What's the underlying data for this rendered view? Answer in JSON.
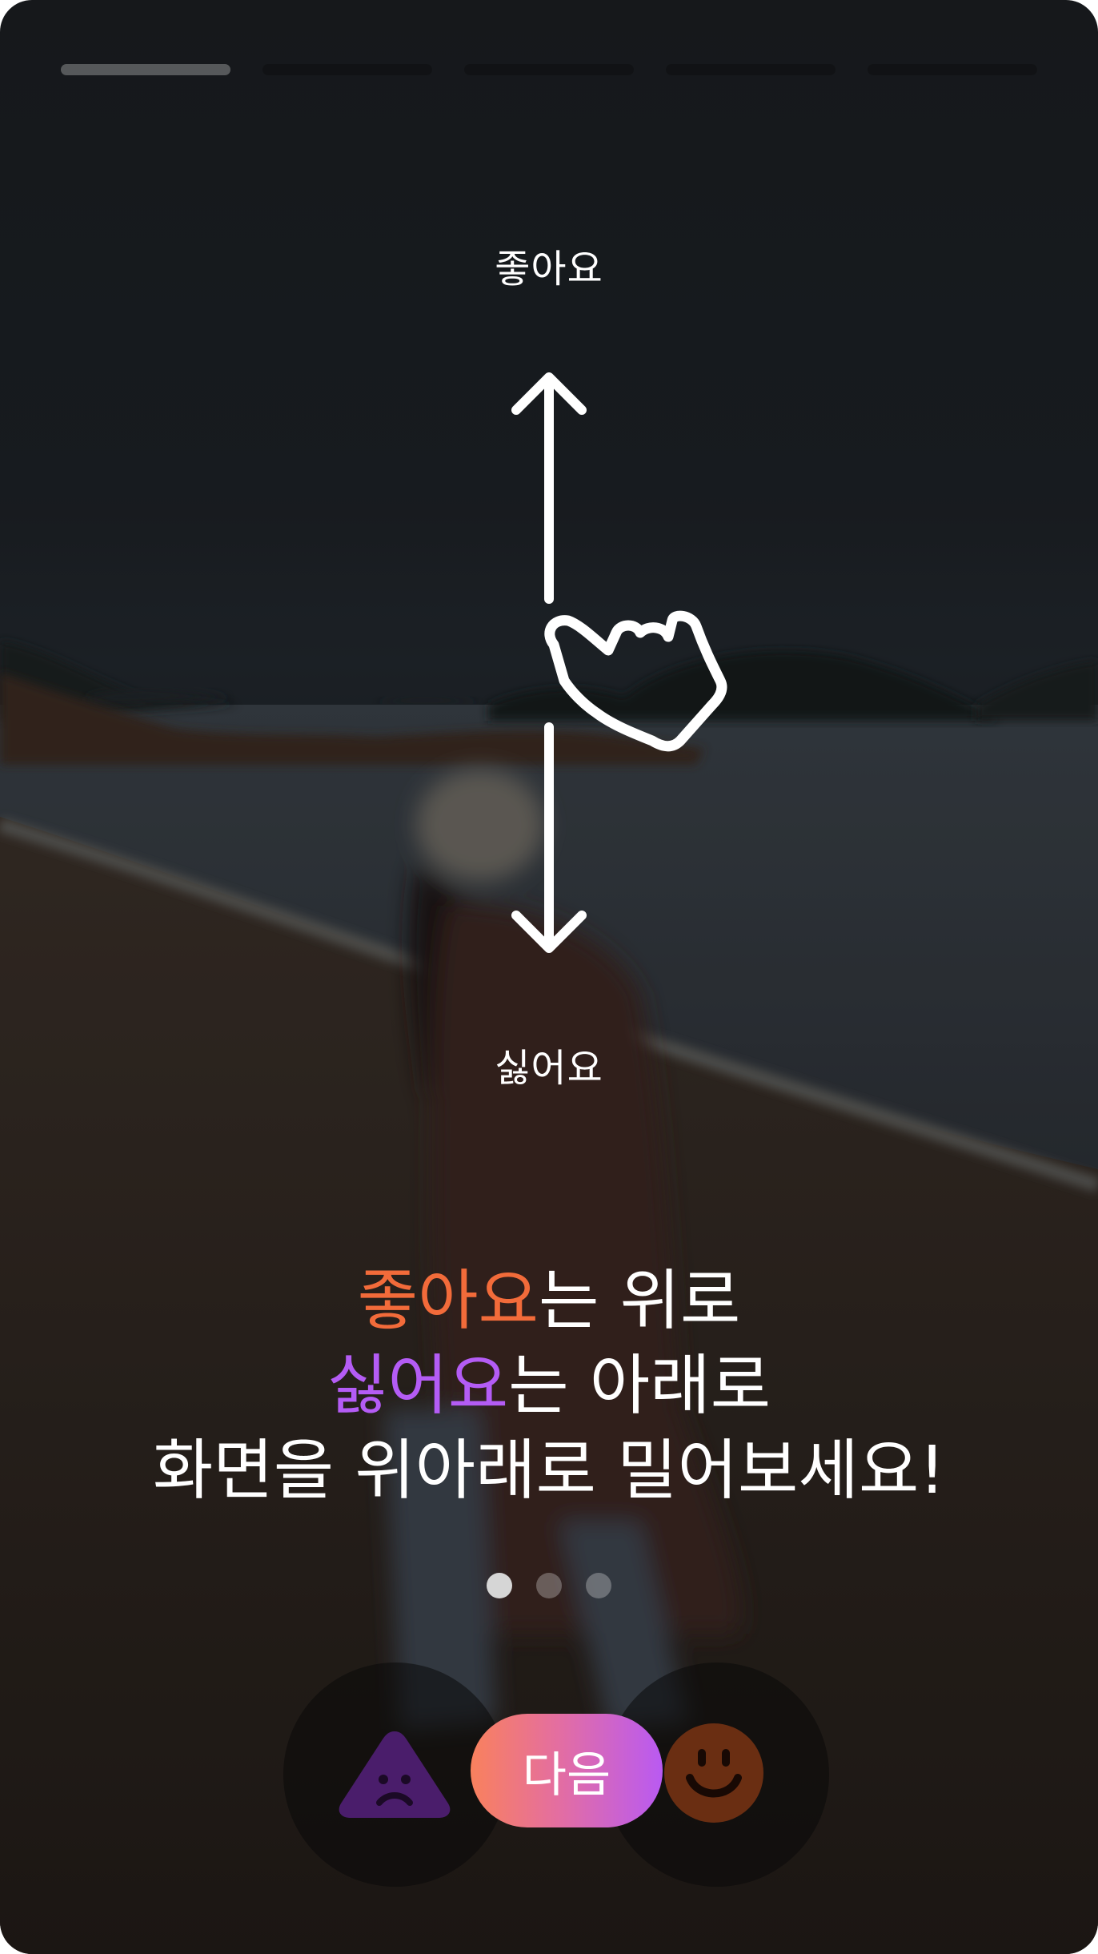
{
  "progress": {
    "segments": 5,
    "active_index": 0
  },
  "gesture": {
    "up_label": "좋아요",
    "down_label": "싫어요"
  },
  "headline": {
    "line1": {
      "highlight": "좋아요",
      "rest": "는 위로"
    },
    "line2": {
      "highlight": "싫어요",
      "rest": "는 아래로"
    },
    "line3": "화면을 위아래로 밀어보세요!"
  },
  "pager": {
    "count": 3,
    "active_index": 0
  },
  "controls": {
    "dislike_icon": "frown-triangle-icon",
    "like_icon": "smile-circle-icon",
    "next_label": "다음"
  },
  "colors": {
    "like": "#f26b3a",
    "dislike": "#b45cf5",
    "button_gradient_start": "#f9815d",
    "button_gradient_end": "#b95af2"
  }
}
